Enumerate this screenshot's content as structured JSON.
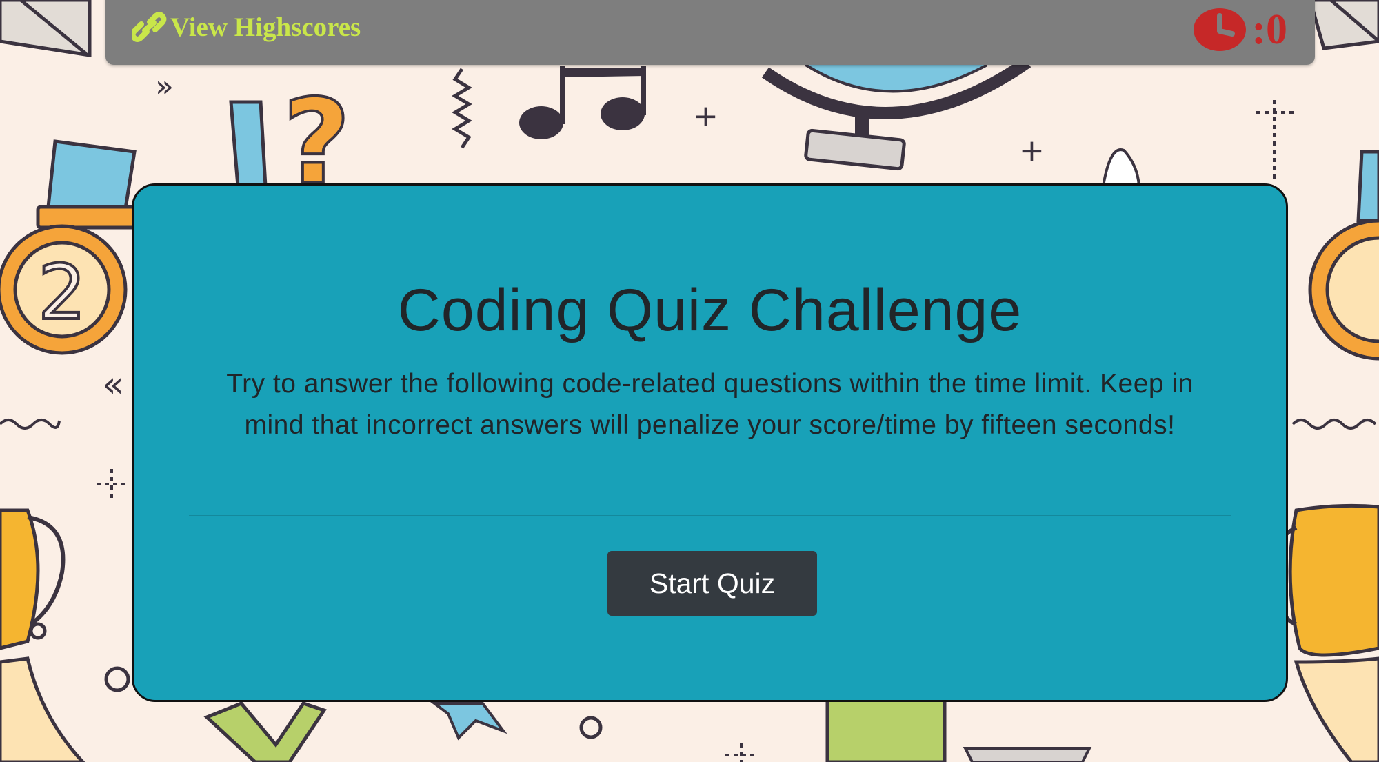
{
  "navbar": {
    "highscores_label": "View Highscores",
    "link_icon": "link-icon",
    "timer_icon": "clock-icon",
    "timer_value": ":0",
    "link_color": "#c9e64a",
    "timer_color": "#c62828"
  },
  "card": {
    "title": "Coding Quiz Challenge",
    "description": "Try to answer the following code-related questions within the time limit. Keep in mind that incorrect answers will penalize your score/time by fifteen seconds!",
    "start_button_label": "Start Quiz",
    "background_color": "#18a1b8"
  },
  "background": {
    "medal_number": "2"
  }
}
